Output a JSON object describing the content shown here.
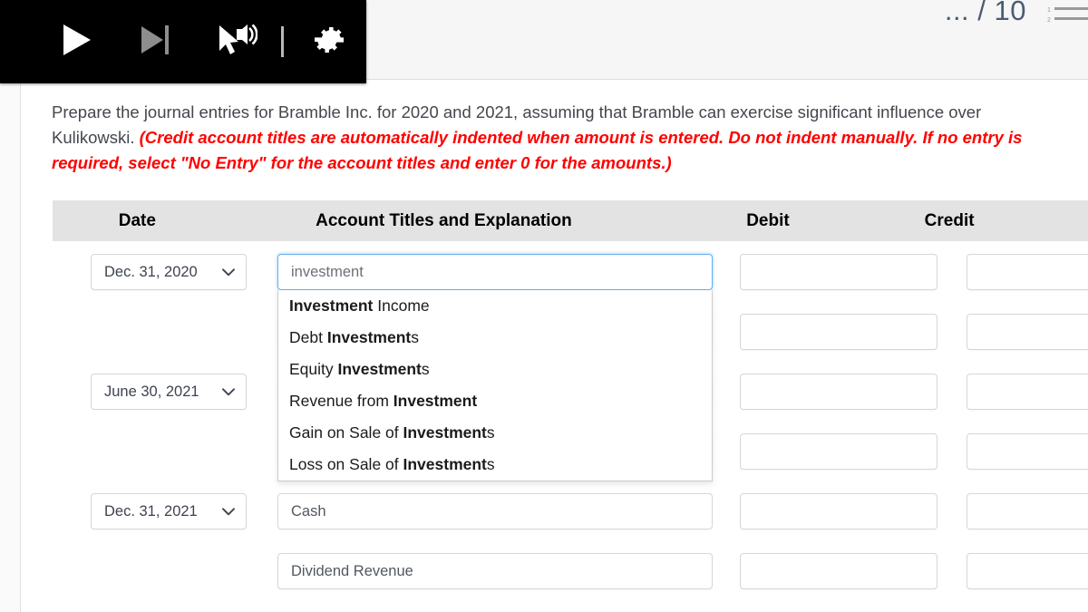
{
  "header": {
    "page_counter": "... / 10",
    "outline_icon": "list-outline-icon"
  },
  "video_toolbar": {
    "play_label": "play-icon",
    "next_label": "skip-next-icon",
    "cursor_audio_label": "cursor-audio-icon",
    "settings_label": "gear-icon"
  },
  "prompt": {
    "lead": "Prepare the journal entries for Bramble Inc. for 2020 and 2021, assuming that Bramble can exercise significant influence over Kulikowski. ",
    "instruction": "(Credit account titles are automatically indented when amount is entered. Do not indent manually. If no entry is required, select \"No Entry\" for the account titles and enter 0 for the amounts.)"
  },
  "table": {
    "headers": {
      "date": "Date",
      "account": "Account Titles and Explanation",
      "debit": "Debit",
      "credit": "Credit"
    },
    "rows": [
      {
        "date": "Dec. 31, 2020",
        "account": "investment",
        "account_focused": true,
        "debit": "",
        "credit": ""
      },
      {
        "date": "",
        "account": "",
        "account_focused": false,
        "debit": "",
        "credit": ""
      },
      {
        "date": "June 30, 2021",
        "account": "",
        "account_focused": false,
        "debit": "",
        "credit": ""
      },
      {
        "date": "",
        "account": "",
        "account_focused": false,
        "debit": "",
        "credit": ""
      },
      {
        "date": "Dec. 31, 2021",
        "account": "Cash",
        "account_focused": false,
        "debit": "",
        "credit": ""
      },
      {
        "date": "",
        "account": "Dividend Revenue",
        "account_focused": false,
        "debit": "",
        "credit": ""
      }
    ]
  },
  "autocomplete": {
    "visible": true,
    "query": "investment",
    "options": [
      {
        "pre": "",
        "match": "Investment",
        "post": " Income"
      },
      {
        "pre": "Debt ",
        "match": "Investment",
        "post": "s"
      },
      {
        "pre": "Equity ",
        "match": "Investment",
        "post": "s"
      },
      {
        "pre": "Revenue from ",
        "match": "Investment",
        "post": ""
      },
      {
        "pre": "Gain on Sale of ",
        "match": "Investment",
        "post": "s"
      },
      {
        "pre": "Loss on Sale of ",
        "match": "Investment",
        "post": "s"
      }
    ]
  },
  "colors": {
    "instruction_red": "#ff0000",
    "header_band": "#e3e3e3",
    "focus_blue": "#66afe9",
    "toolbar_black": "#000000"
  }
}
